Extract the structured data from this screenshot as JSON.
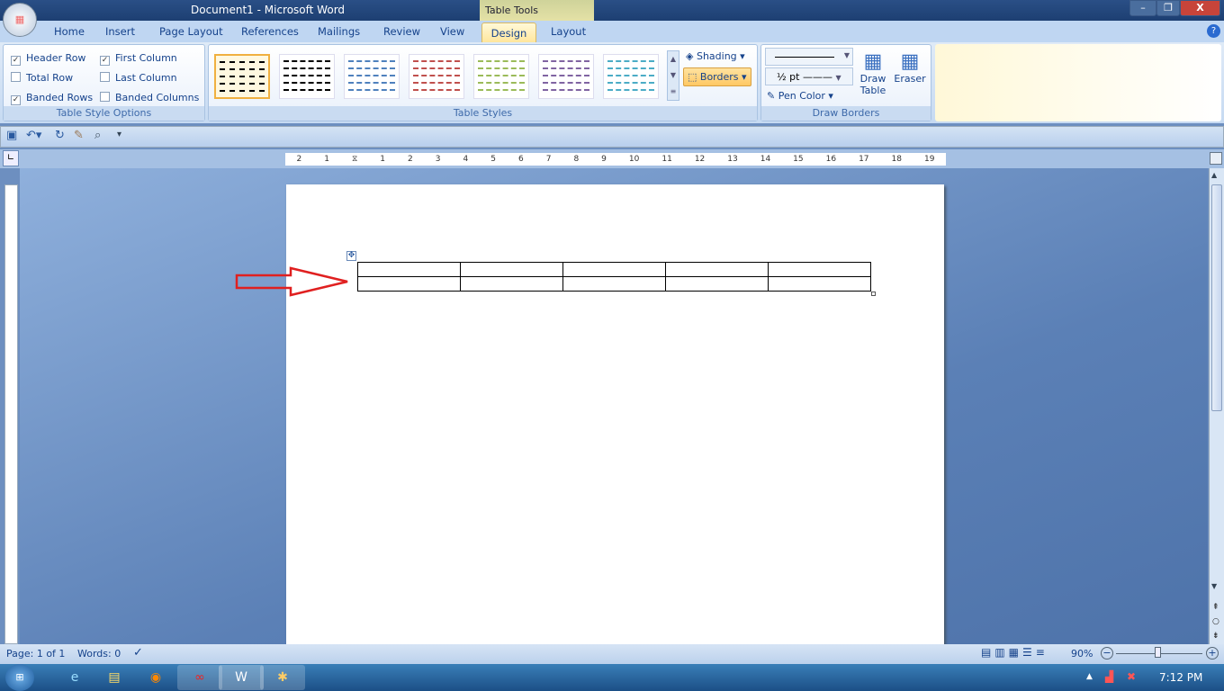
{
  "window": {
    "title": "Document1 - Microsoft Word",
    "context_tab": "Table Tools",
    "minimize": "–",
    "restore": "❐",
    "close": "X"
  },
  "tabs": [
    "Home",
    "Insert",
    "Page Layout",
    "References",
    "Mailings",
    "Review",
    "View",
    "Design",
    "Layout"
  ],
  "active_tab": "Design",
  "ribbon": {
    "table_style_options": {
      "label": "Table Style Options",
      "options": [
        {
          "label": "Header Row",
          "checked": true
        },
        {
          "label": "First Column",
          "checked": true
        },
        {
          "label": "Total Row",
          "checked": false
        },
        {
          "label": "Last Column",
          "checked": false
        },
        {
          "label": "Banded Rows",
          "checked": true
        },
        {
          "label": "Banded Columns",
          "checked": false
        }
      ]
    },
    "table_styles": {
      "label": "Table Styles",
      "swatch_colors": [
        "#000000",
        "#000000",
        "#4f81bd",
        "#c0504d",
        "#9bbb59",
        "#8064a2",
        "#4bacc6"
      ]
    },
    "shading": "Shading",
    "borders": "Borders",
    "draw_borders": {
      "label": "Draw Borders",
      "pen_weight": "½ pt",
      "pen_color": "Pen Color",
      "draw_table": "Draw Table",
      "eraser": "Eraser"
    }
  },
  "ruler": {
    "labels": [
      "2",
      "1",
      "",
      "1",
      "2",
      "3",
      "4",
      "5",
      "6",
      "7",
      "8",
      "9",
      "10",
      "11",
      "12",
      "13",
      "14",
      "15",
      "16",
      "17",
      "18",
      "19"
    ]
  },
  "document": {
    "table": {
      "rows": 2,
      "cols": 5
    }
  },
  "status": {
    "page": "Page: 1 of 1",
    "words": "Words: 0",
    "zoom": "90%",
    "zoom_level_percent": 90
  },
  "taskbar": {
    "clock": "7:12 PM"
  },
  "colors": {
    "arrow": "#e02020",
    "ribbon_accent": "#ffe59a"
  }
}
